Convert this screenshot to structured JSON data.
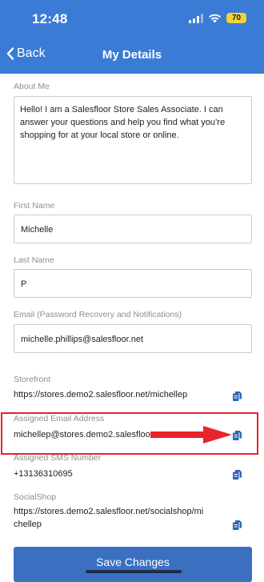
{
  "status_bar": {
    "time": "12:48",
    "battery": "70"
  },
  "nav": {
    "back_label": "Back",
    "title": "My Details"
  },
  "about_me": {
    "label": "About Me",
    "value": "Hello! I am a Salesfloor Store Sales Associate. I can answer your questions and help you find what you’re shopping for at your local store or online."
  },
  "first_name": {
    "label": "First Name",
    "value": "Michelle"
  },
  "last_name": {
    "label": "Last Name",
    "value": "P"
  },
  "email": {
    "label": "Email (Password Recovery and Notifications)",
    "value": "michelle.phillips@salesfloor.net"
  },
  "storefront": {
    "label": "Storefront",
    "value": "https://stores.demo2.salesfloor.net/michellep"
  },
  "assigned_email": {
    "label": "Assigned Email Address",
    "value": "michellep@stores.demo2.salesfloor.net"
  },
  "assigned_sms": {
    "label": "Assigned SMS Number",
    "value": "+13136310695"
  },
  "socialshop": {
    "label": "SocialShop",
    "value_line1": "https://stores.demo2.salesfloor.net/socialshop/mi",
    "value_line2": "chellep"
  },
  "save_button": {
    "label": "Save Changes"
  },
  "icons": {
    "copy": "copy-icon",
    "back": "chevron-left-icon",
    "wifi": "wifi-icon",
    "signal": "signal-icon",
    "battery": "battery-icon"
  },
  "colors": {
    "header": "#3a7bd5",
    "button": "#3b6fc0",
    "copy_icon": "#2f62b8",
    "annotation": "#e8232a",
    "battery": "#f4d335"
  }
}
